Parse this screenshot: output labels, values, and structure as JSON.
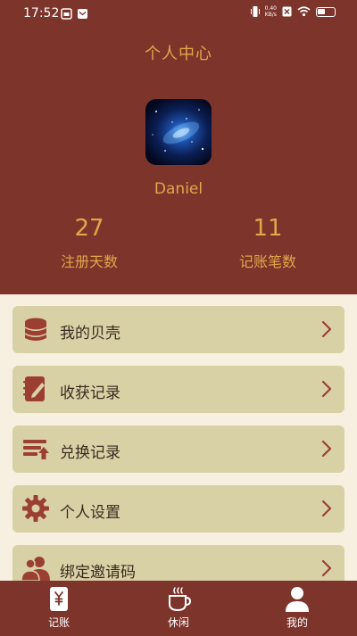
{
  "status_bar": {
    "time": "17:52",
    "net_speed_value": "0.40",
    "net_speed_unit": "KB/s"
  },
  "header": {
    "title": "个人中心"
  },
  "user": {
    "name": "Daniel"
  },
  "stats": [
    {
      "value": "27",
      "label": "注册天数"
    },
    {
      "value": "11",
      "label": "记账笔数"
    }
  ],
  "menu": [
    {
      "label": "我的贝壳",
      "icon": "coins-icon"
    },
    {
      "label": "收获记录",
      "icon": "notebook-pen-icon"
    },
    {
      "label": "兑换记录",
      "icon": "stack-upload-icon"
    },
    {
      "label": "个人设置",
      "icon": "gear-icon"
    },
    {
      "label": "绑定邀请码",
      "icon": "users-icon"
    }
  ],
  "tabbar": [
    {
      "label": "记账",
      "icon": "ledger-yen-icon"
    },
    {
      "label": "休闲",
      "icon": "coffee-cup-icon"
    },
    {
      "label": "我的",
      "icon": "person-icon"
    }
  ],
  "colors": {
    "header_bg": "#7d342b",
    "accent": "#e0a74b",
    "menu_bg": "#d9d1a6",
    "page_bg": "#f7f0e1"
  }
}
